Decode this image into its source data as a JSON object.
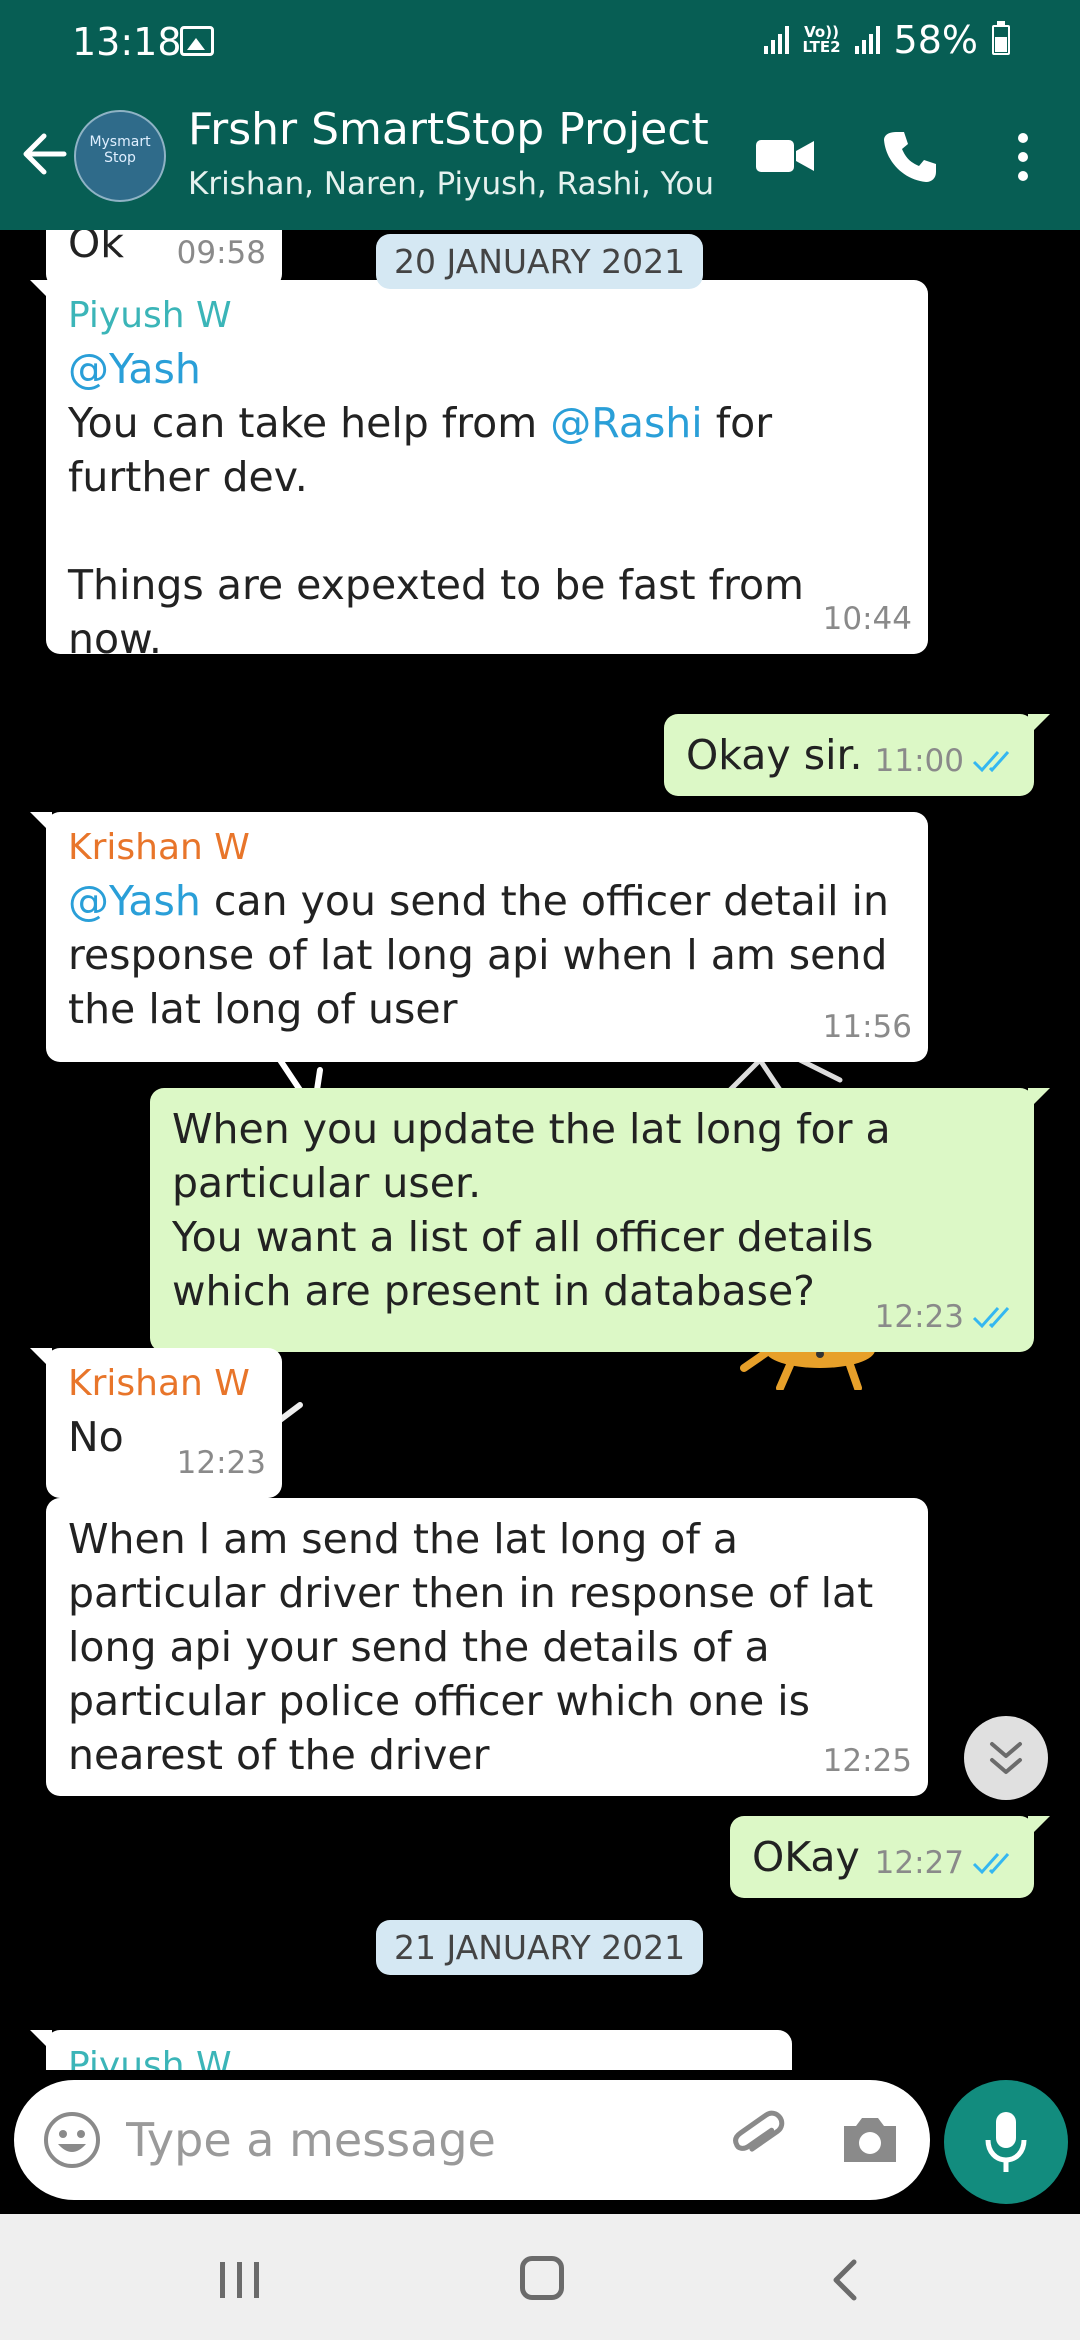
{
  "status_bar": {
    "time": "13:18",
    "network": "Vo)) LTE2",
    "battery": "58%"
  },
  "header": {
    "avatar_text": "Mysmart Stop",
    "title": "Frshr SmartStop Project",
    "subtitle": "Krishan, Naren, Piyush, Rashi, You",
    "icons": [
      "back-arrow-icon",
      "video-call-icon",
      "voice-call-icon",
      "more-options-icon"
    ]
  },
  "chat": {
    "date_1": "20 JANUARY 2021",
    "date_2": "21 JANUARY 2021",
    "cut_top_time": "09:58",
    "cut_top_text": "Ok",
    "cut_bottom_sender": "Piyush W",
    "messages": [
      {
        "sender": "Piyush W",
        "mention": "@Yash",
        "line1_prefix": "You can take help from ",
        "line1_mention": "@Rashi",
        "line1_suffix": " for",
        "line2": "further dev.",
        "line3": "Things are expexted to be fast from now.",
        "time": "10:44"
      },
      {
        "text": "Okay sir.",
        "time": "11:00",
        "status": "read"
      },
      {
        "sender": "Krishan W",
        "mention": "@Yash",
        "text_after_mention": " can you send the officer detail in",
        "line2": "response of lat long api when l am send",
        "line3": "the lat long of user",
        "time": "11:56"
      },
      {
        "line1": "When you update the lat long for a",
        "line2": "particular user.",
        "line3": "You want a list of all officer  details",
        "line4": "which are present  in database?",
        "time": "12:23",
        "status": "read"
      },
      {
        "sender": "Krishan W",
        "text": "No",
        "time": "12:23"
      },
      {
        "line1": "When l am send the lat long of a",
        "line2": "particular driver then in response of lat",
        "line3": "long api your send the details of a",
        "line4": "particular police officer which one is",
        "line5": "nearest of the driver",
        "time": "12:25"
      },
      {
        "text": "OKay",
        "time": "12:27",
        "status": "read"
      }
    ]
  },
  "input": {
    "placeholder": "Type a message"
  },
  "colors": {
    "header": "#075e54",
    "outgoing_bubble": "#dcf8c6",
    "incoming_bubble": "#ffffff",
    "mention": "#2a9fd8",
    "mic_button": "#128c7e",
    "read_ticks": "#34b7f1"
  }
}
